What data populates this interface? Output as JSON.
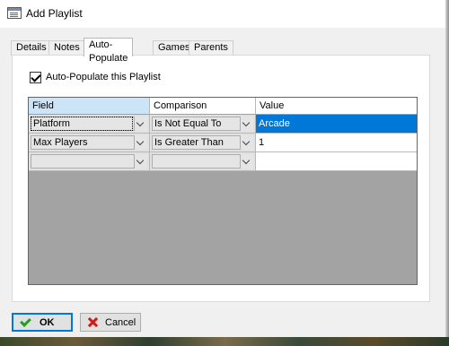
{
  "window": {
    "title": "Add Playlist"
  },
  "tabs": [
    {
      "label": "Details"
    },
    {
      "label": "Notes"
    },
    {
      "label": "Auto-Populate"
    },
    {
      "label": "Games"
    },
    {
      "label": "Parents"
    }
  ],
  "active_tab": "Auto-Populate",
  "auto_populate": {
    "checkbox_label": "Auto-Populate this Playlist",
    "checked": true
  },
  "grid": {
    "headers": [
      "Field",
      "Comparison",
      "Value"
    ],
    "rows": [
      {
        "field": "Platform",
        "comparison": "Is Not Equal To",
        "value": "Arcade"
      },
      {
        "field": "Max Players",
        "comparison": "Is Greater Than",
        "value": "1"
      },
      {
        "field": "",
        "comparison": "",
        "value": ""
      }
    ]
  },
  "buttons": {
    "ok": "OK",
    "cancel": "Cancel"
  },
  "colors": {
    "selection": "#0078d7",
    "header_selected": "#cce4f7",
    "grid_empty": "#a3a3a3"
  },
  "icons": {
    "window": "window-icon",
    "ok": "green-checkmark-icon",
    "cancel": "red-x-icon",
    "combo": "chevron-down-icon"
  }
}
